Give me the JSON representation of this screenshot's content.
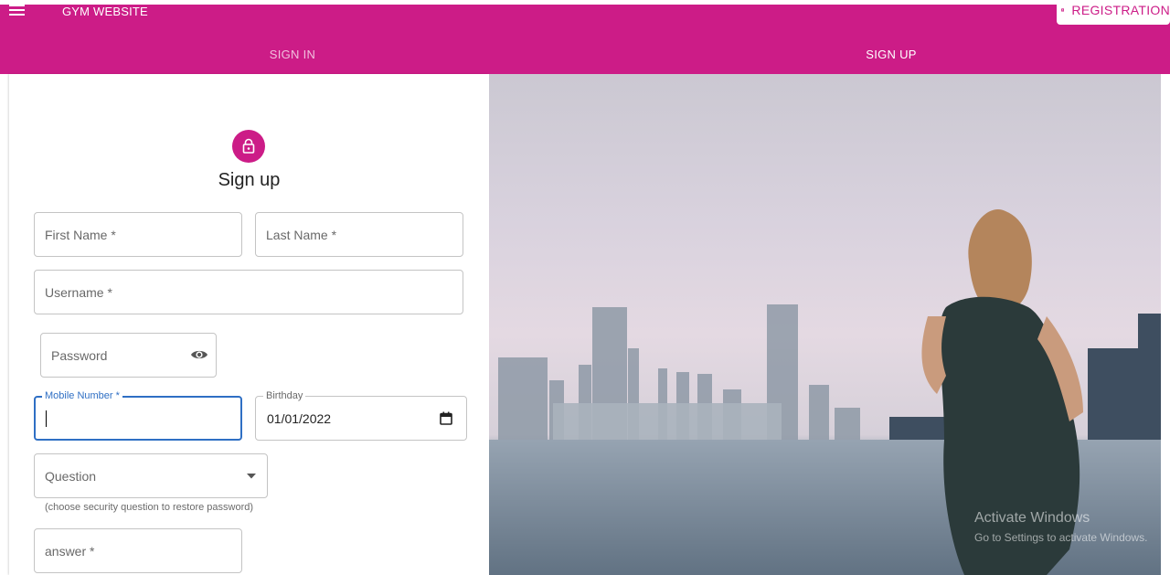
{
  "appbar": {
    "title": "GYM WEBSITE",
    "registration_label": "REGISTRATION",
    "menu_icon": "hamburger-menu-icon",
    "registration_icon": "contact-card-icon"
  },
  "tabs": [
    {
      "label": "SIGN IN",
      "active": false
    },
    {
      "label": "SIGN UP",
      "active": true
    }
  ],
  "form": {
    "icon": "lock-icon",
    "heading": "Sign up",
    "first_name": {
      "label": "First Name *",
      "value": ""
    },
    "last_name": {
      "label": "Last Name *",
      "value": ""
    },
    "username": {
      "label": "Username *",
      "value": ""
    },
    "password": {
      "label": "Password",
      "value": "",
      "toggle_icon": "eye-icon"
    },
    "mobile": {
      "label": "Mobile Number *",
      "value": ""
    },
    "birthday": {
      "label": "Birthday",
      "value": "01/01/2022",
      "icon": "calendar-icon"
    },
    "question": {
      "label": "Question",
      "helper": "(choose security question to restore password)",
      "icon": "dropdown-arrow-icon"
    },
    "answer": {
      "label": "answer *",
      "value": ""
    }
  },
  "watermark": {
    "line1": "Activate Windows",
    "line2": "Go to Settings to activate Windows."
  },
  "colors": {
    "primary": "#cc1c87",
    "focus": "#2f6fc4"
  }
}
